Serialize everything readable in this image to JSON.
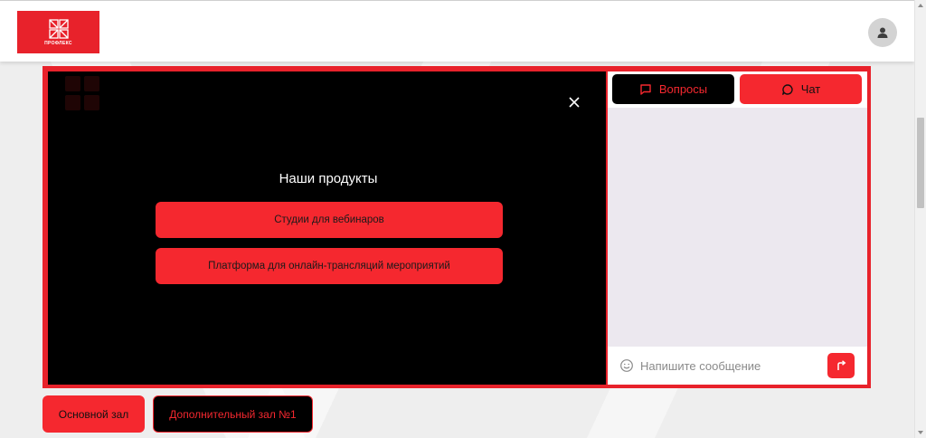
{
  "header": {
    "logo_text": "ПРОФЛЕКС"
  },
  "player": {
    "products_title": "Наши продукты",
    "products": [
      {
        "label": "Студии для вебинаров"
      },
      {
        "label": "Платформа для онлайн-трансляций мероприятий"
      }
    ]
  },
  "chat": {
    "tabs": [
      {
        "label": "Вопросы",
        "icon": "message-square-icon"
      },
      {
        "label": "Чат",
        "icon": "message-circle-icon"
      }
    ],
    "input": {
      "value": "",
      "placeholder": "Напишите сообщение"
    }
  },
  "halls": [
    {
      "label": "Основной зал"
    },
    {
      "label": "Дополнительный зал №1"
    }
  ],
  "colors": {
    "accent": "#f5282f",
    "brand": "#e8222b",
    "player_bg": "#000000",
    "chat_bg": "#ece8ef"
  }
}
